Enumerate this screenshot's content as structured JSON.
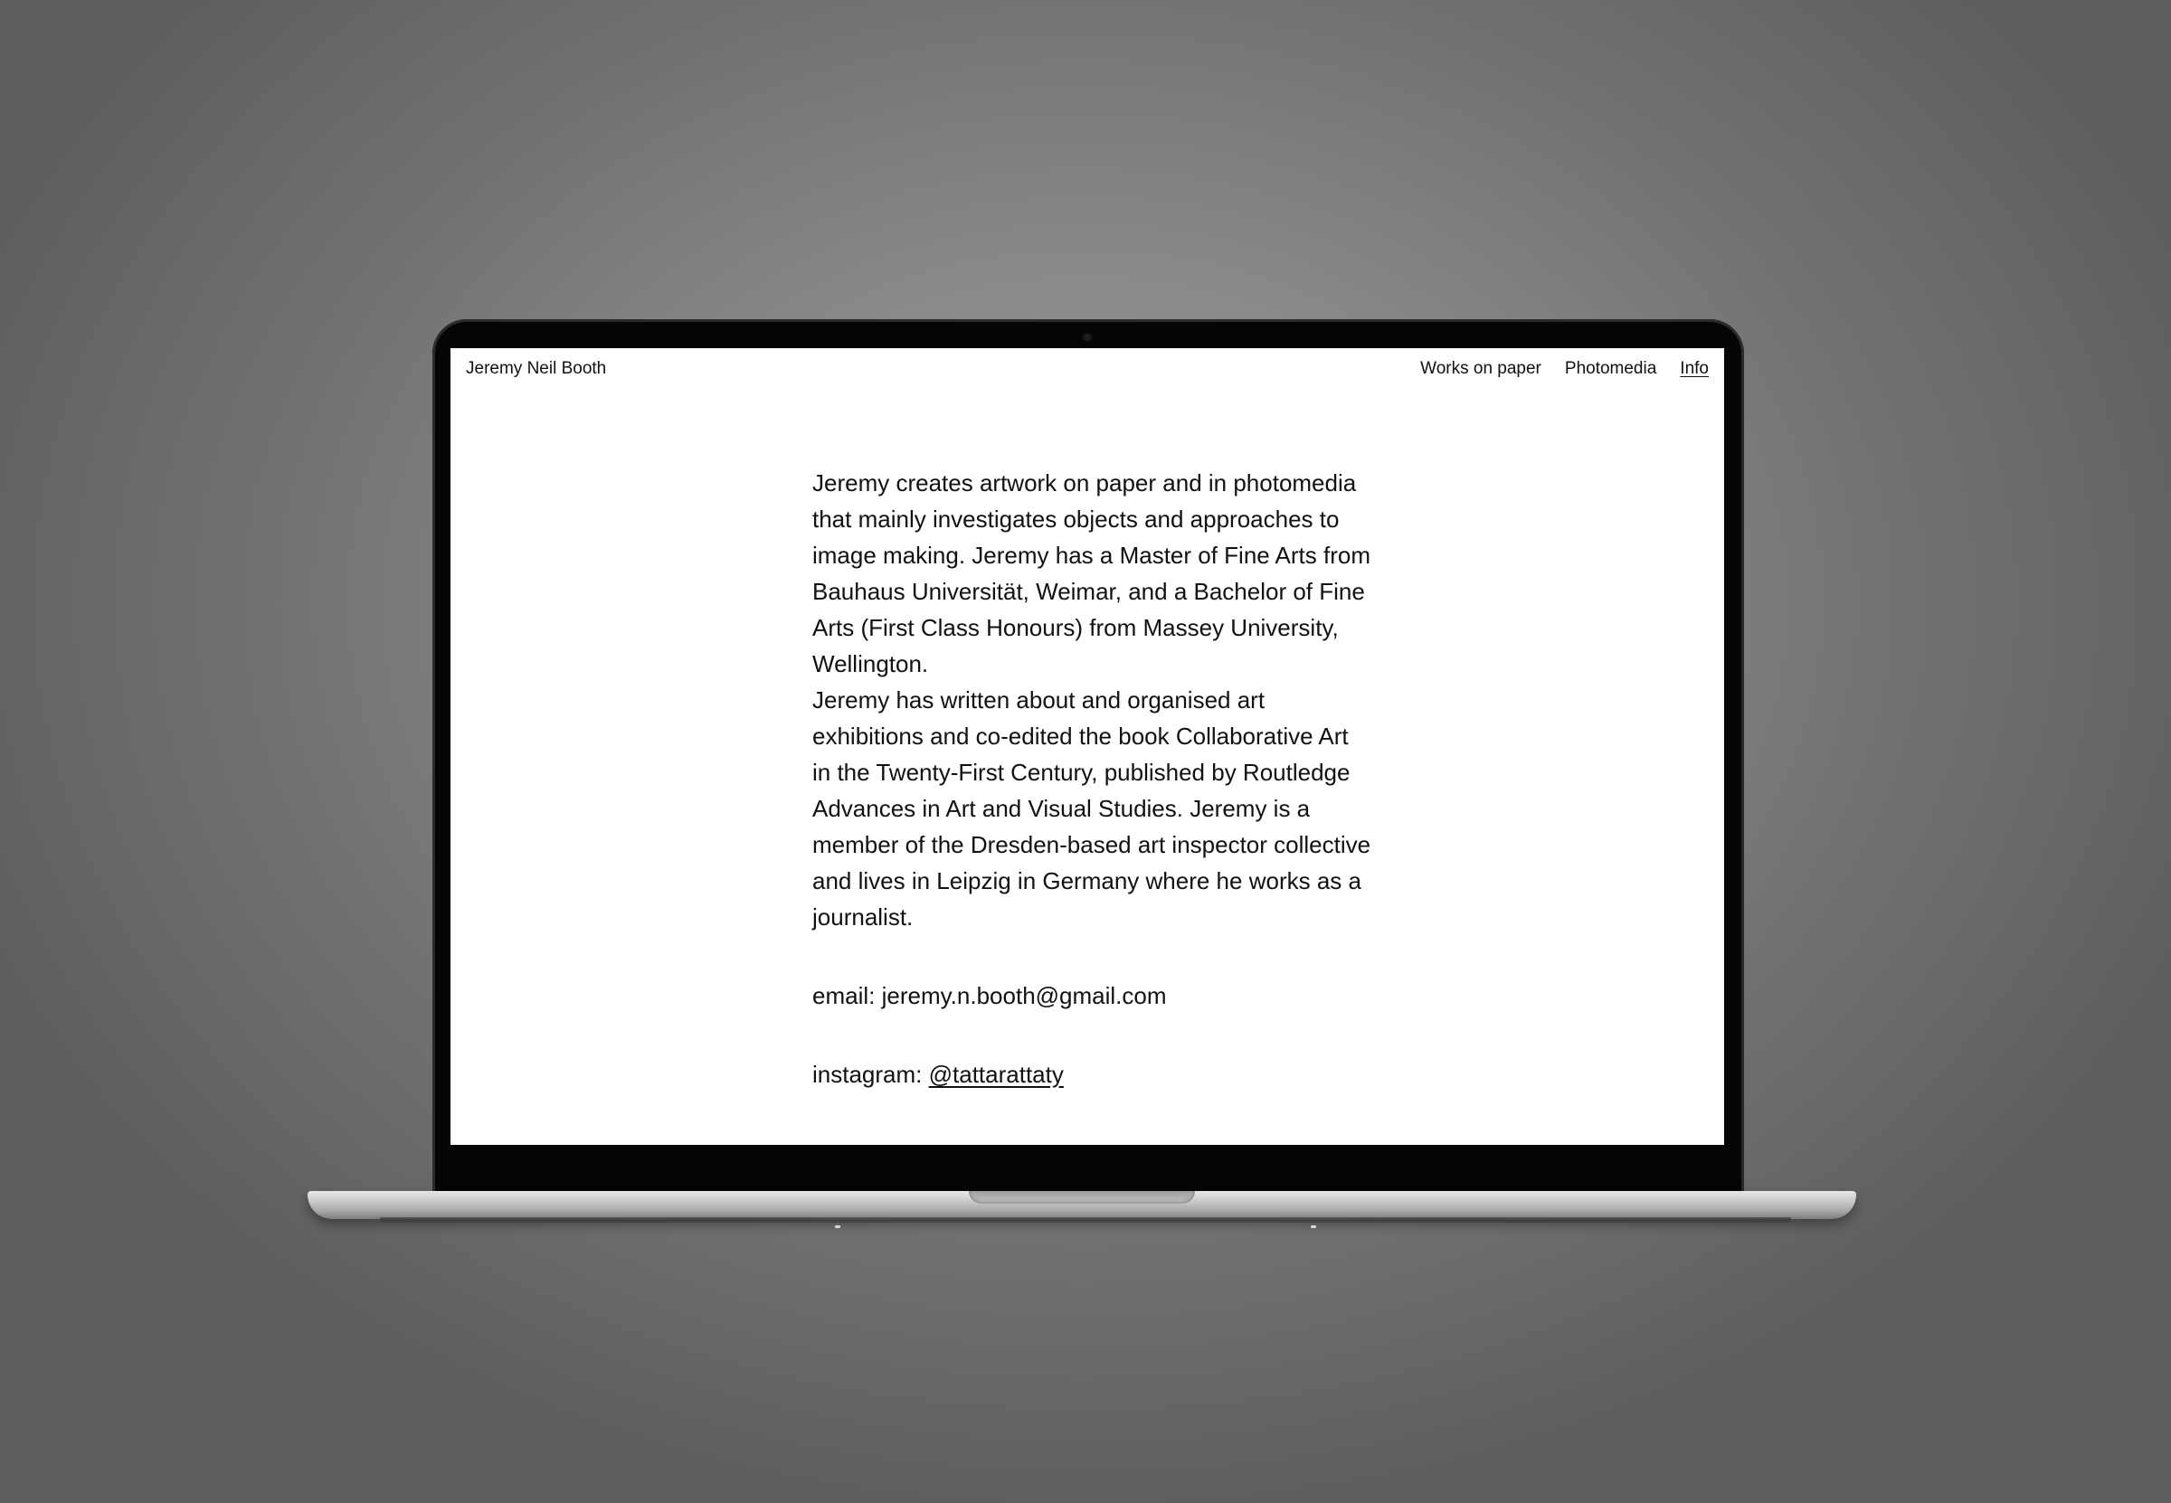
{
  "site": {
    "title": "Jeremy Neil Booth",
    "nav": [
      {
        "label": "Works on paper",
        "active": false
      },
      {
        "label": "Photomedia",
        "active": false
      },
      {
        "label": "Info",
        "active": true
      }
    ]
  },
  "bio": {
    "paragraph_1": "Jeremy creates artwork on paper and in photomedia that mainly investigates objects and approaches to image making. Jeremy has a Master of Fine Arts from Bauhaus Universität, Weimar, and a Bachelor of Fine Arts (First Class Honours) from Massey University, Wellington.",
    "paragraph_2": "Jeremy has written about and organised art exhibitions and co-edited the book Collaborative Art in the Twenty-First Century, published by Routledge Advances in Art and Visual Studies. Jeremy is a member of the Dresden-based art inspector collective and lives in Leipzig in Germany where he works as a journalist."
  },
  "contact": {
    "email_label": "email:",
    "email_value": "jeremy.n.booth@gmail.com",
    "instagram_label": "instagram:",
    "instagram_handle": "@tattarattaty"
  },
  "colors": {
    "background": "#8a8a8a",
    "screen": "#ffffff",
    "text": "#111111",
    "bezel": "#050505"
  }
}
